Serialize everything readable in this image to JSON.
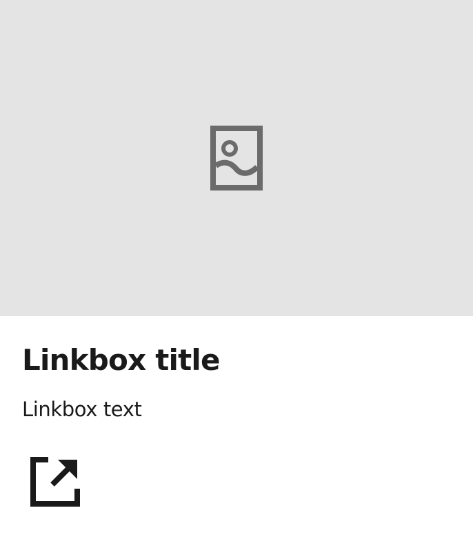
{
  "linkbox": {
    "title": "Linkbox title",
    "text": "Linkbox text",
    "image": {
      "icon": "image-placeholder-icon",
      "background_color": "#e4e4e4",
      "icon_color": "#6b6b6b"
    },
    "link_icon": "external-link-icon",
    "text_color": "#1a1a1a"
  }
}
